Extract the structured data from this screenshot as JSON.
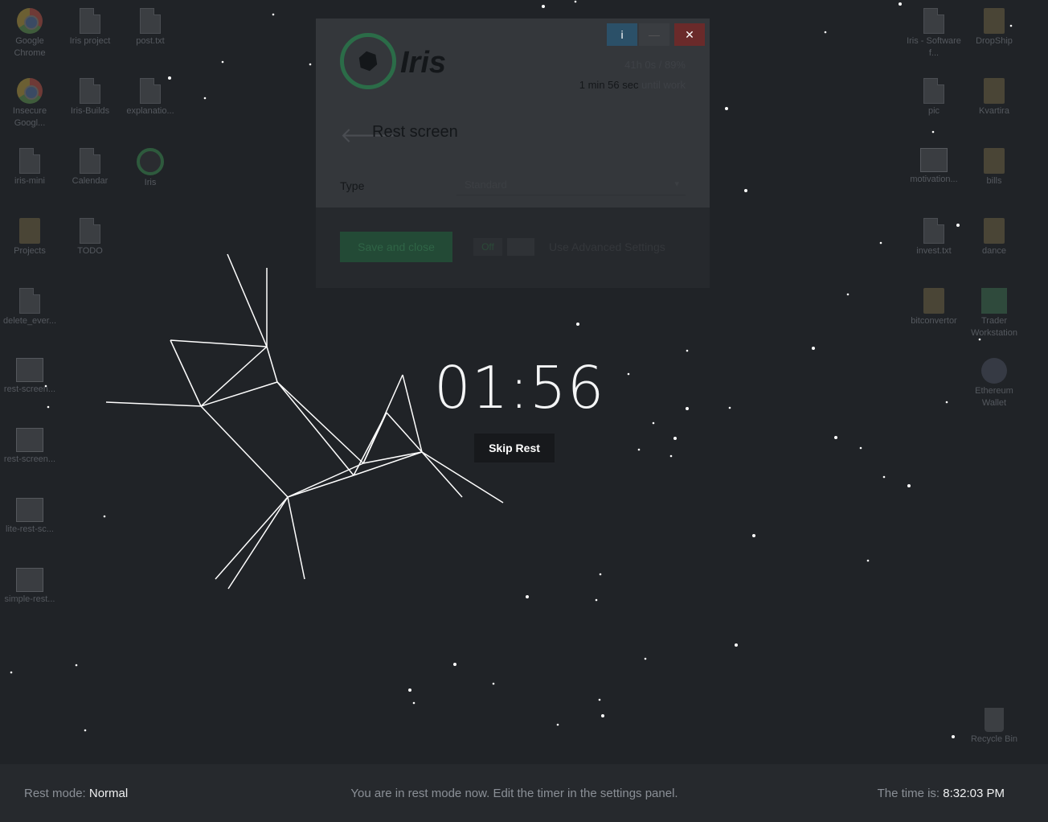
{
  "desktop_left": [
    {
      "label": "Google Chrome",
      "icon": "chrome-icon",
      "kind": "chrome"
    },
    {
      "label": "Iris project",
      "icon": "shortcut-icon",
      "kind": "doc"
    },
    {
      "label": "post.txt",
      "icon": "text-file-icon",
      "kind": "doc"
    },
    {
      "label": "Insecure Googl...",
      "icon": "chrome-icon",
      "kind": "chrome"
    },
    {
      "label": "Iris-Builds",
      "icon": "shortcut-icon",
      "kind": "doc"
    },
    {
      "label": "explanatio...",
      "icon": "text-file-icon",
      "kind": "doc"
    },
    {
      "label": "iris-mini",
      "icon": "shortcut-icon",
      "kind": "doc"
    },
    {
      "label": "Calendar",
      "icon": "shortcut-icon",
      "kind": "doc"
    },
    {
      "label": "Iris",
      "icon": "iris-app-icon",
      "kind": "iris"
    },
    {
      "label": "Projects",
      "icon": "folder-icon",
      "kind": "folder"
    },
    {
      "label": "TODO",
      "icon": "shortcut-icon",
      "kind": "doc"
    },
    {
      "label": "delete_ever...",
      "icon": "script-icon",
      "kind": "doc"
    },
    {
      "label": "rest-screen...",
      "icon": "image-file-icon",
      "kind": "screen"
    },
    {
      "label": "rest-screen...",
      "icon": "image-file-icon",
      "kind": "screen"
    },
    {
      "label": "lite-rest-sc...",
      "icon": "image-file-icon",
      "kind": "screen"
    },
    {
      "label": "simple-rest...",
      "icon": "image-file-icon",
      "kind": "screen"
    }
  ],
  "desktop_right": [
    {
      "label": "Iris - Software f...",
      "icon": "shortcut-icon",
      "kind": "doc"
    },
    {
      "label": "DropShip",
      "icon": "folder-icon",
      "kind": "folder"
    },
    {
      "label": "pic",
      "icon": "shortcut-icon",
      "kind": "doc"
    },
    {
      "label": "Kvartira",
      "icon": "folder-icon",
      "kind": "folder"
    },
    {
      "label": "motivation...",
      "icon": "image-file-icon",
      "kind": "screen"
    },
    {
      "label": "bills",
      "icon": "folder-icon",
      "kind": "folder"
    },
    {
      "label": "invest.txt",
      "icon": "text-file-icon",
      "kind": "doc"
    },
    {
      "label": "dance",
      "icon": "folder-icon",
      "kind": "folder"
    },
    {
      "label": "bitconvertor",
      "icon": "folder-icon",
      "kind": "folder"
    },
    {
      "label": "Trader Workstation",
      "icon": "tws-icon",
      "kind": "tws"
    },
    {
      "label": "Ethereum Wallet",
      "icon": "ethereum-icon",
      "kind": "eth"
    },
    {
      "label": "Recycle Bin",
      "icon": "recycle-bin-icon",
      "kind": "bin"
    }
  ],
  "iris_window": {
    "logo_text": "Iris",
    "info_btn": "i",
    "min_btn": "—",
    "close_btn": "✕",
    "stat1": "41h 0s / 89%",
    "stat2_time": "1 min 56 sec",
    "stat2_suffix": " until work",
    "panel_title": "Rest screen",
    "type_label": "Type",
    "type_value": "Standard",
    "save_label": "Save and close",
    "toggle_label": "Off",
    "advanced_label": "Use Advanced Settings"
  },
  "timer": {
    "value": "01:56"
  },
  "skip_label": "Skip Rest",
  "status": {
    "mode_label": "Rest mode:",
    "mode_value": "Normal",
    "message": "You are in rest mode now. Edit the timer in the settings panel.",
    "time_label": "The time is:",
    "time_value": "8:32:03 PM"
  },
  "colors": {
    "background": "#202327",
    "accent": "#2b6c48",
    "statusbar": "#26292d"
  }
}
